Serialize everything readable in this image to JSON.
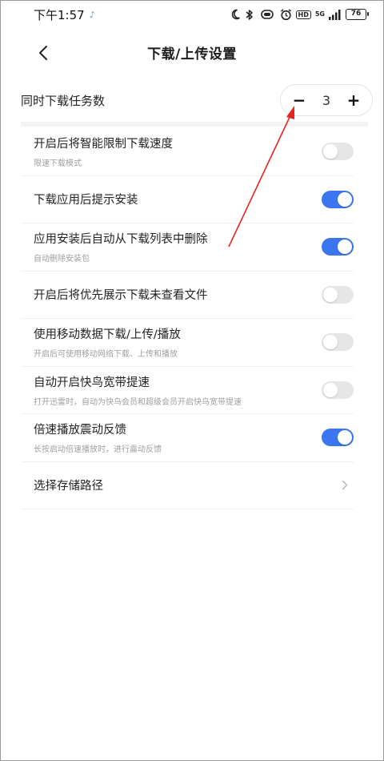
{
  "status_bar": {
    "time": "下午1:57",
    "note_glyph": "♪",
    "hd_label": "HD",
    "network_label": "5G",
    "battery": "76",
    "icons": [
      "moon-icon",
      "bluetooth-icon",
      "vibrate-icon",
      "alarm-icon",
      "hd-icon",
      "signal-icon",
      "battery-icon"
    ]
  },
  "header": {
    "title": "下载/上传设置",
    "back_icon": "chevron-left-icon"
  },
  "concurrent": {
    "label": "同时下载任务数",
    "value": "3",
    "minus": "−",
    "plus": "+"
  },
  "settings": [
    {
      "title": "开启后将智能限制下载速度",
      "subtitle": "限速下载模式",
      "state": "off"
    },
    {
      "title": "下载应用后提示安装",
      "subtitle": "",
      "state": "on"
    },
    {
      "title": "应用安装后自动从下载列表中删除",
      "subtitle": "自动删除安装包",
      "state": "on"
    },
    {
      "title": "开启后将优先展示下载未查看文件",
      "subtitle": "",
      "state": "off"
    },
    {
      "title": "使用移动数据下载/上传/播放",
      "subtitle": "开启后可使用移动网络下载、上传和播放",
      "state": "off"
    },
    {
      "title": "自动开启快鸟宽带提速",
      "subtitle": "打开迅雷时，自动为快鸟会员和超级会员开启快鸟宽带提速",
      "state": "off"
    },
    {
      "title": "倍速播放震动反馈",
      "subtitle": "长按启动倍速播放时，进行震动反馈",
      "state": "on"
    }
  ],
  "storage": {
    "title": "选择存储路径",
    "icon": "chevron-right-icon"
  },
  "colors": {
    "accent": "#3b76f0",
    "toggle_off": "#e6e6e6",
    "annotation": "#e8231f"
  }
}
